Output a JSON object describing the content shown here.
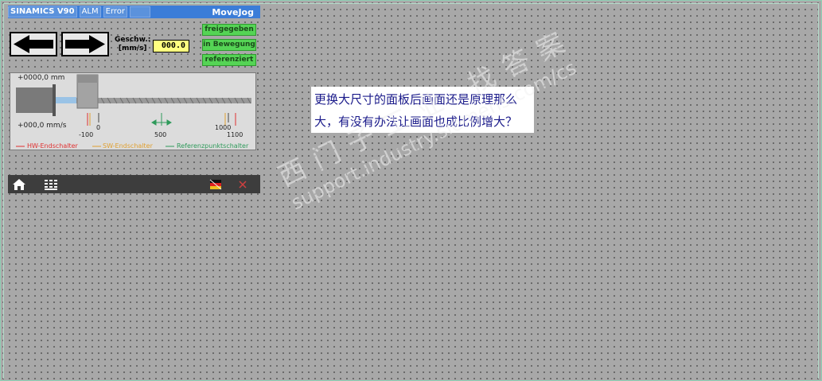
{
  "header": {
    "device": "SINAMICS V90",
    "alarm": "ALM",
    "error": "Error",
    "mode": "MoveJog"
  },
  "controls": {
    "speed_label_line1": "Geschw.:",
    "speed_label_line2": "[mm/s]",
    "speed_value": "000.0"
  },
  "status": {
    "enabled": "freigegeben",
    "moving": "in Bewegung",
    "referenced": "referenziert"
  },
  "axis": {
    "position": "+0000,0 mm",
    "velocity": "+000,0 mm/s",
    "ticks": [
      "0",
      "500",
      "1000",
      "-100",
      "1100"
    ],
    "legend_hw": "HW-Endschalter",
    "legend_sw": "SW-Endschalter",
    "legend_ref": "Referenzpunktschalter"
  },
  "toolbar": {
    "icons": [
      "home-icon",
      "keypad-icon",
      "language-flag-icon",
      "close-icon"
    ]
  },
  "message": {
    "line1": "更换大尺寸的面板后画面还是原理那么",
    "line2": "大，有没有办法让画面也成比例增大？"
  },
  "watermark": {
    "line1": "西门子工业  找答案",
    "line2": "support.industry.siemens.com/cs"
  },
  "colors": {
    "header_blue": "#3b7dd8",
    "status_green": "#55d455",
    "speed_field": "#ffff80",
    "hw_limit": "#e03030",
    "sw_limit": "#e0a030",
    "ref_switch": "#2e9a5a",
    "message_text": "#1a1a8a"
  }
}
